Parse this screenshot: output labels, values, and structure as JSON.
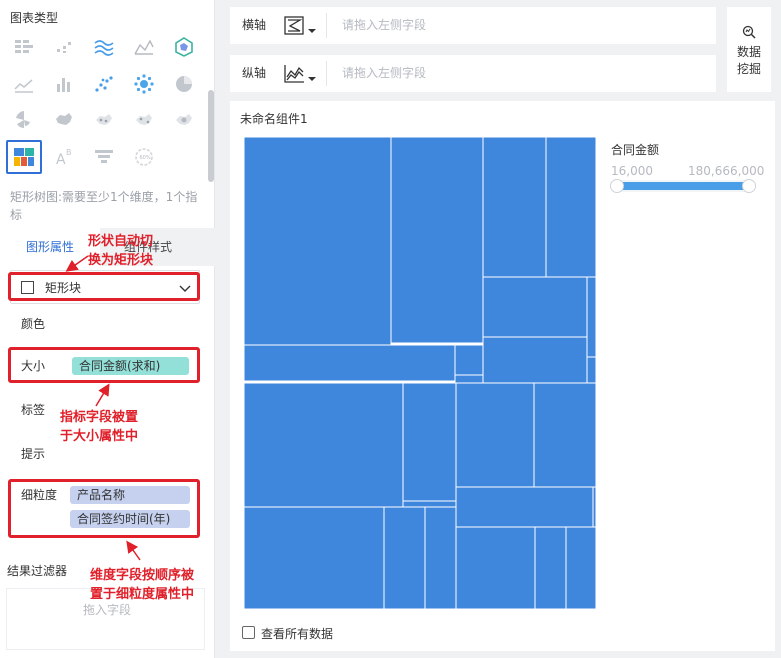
{
  "left_panel": {
    "chart_type_title": "图表类型",
    "chart_icons": [
      "table-icon",
      "scatter-small-icon",
      "multi-line-icon",
      "area-line-icon",
      "radar-icon",
      "line-icon",
      "bar-icon",
      "dot-scatter-icon",
      "bubble-icon",
      "pie-icon",
      "rose-icon",
      "china-map-icon",
      "point-map-icon",
      "flow-map-icon",
      "heat-map-icon",
      "treemap-icon",
      "text-icon",
      "funnel-icon",
      "gauge-icon"
    ],
    "hint": "矩形树图:需要至少1个维度，1个指标",
    "tabs": {
      "graph_props": "图形属性",
      "component_style": "组件样式"
    },
    "shape": "矩形块",
    "color_label": "颜色",
    "size_label": "大小",
    "size_field": "合同金额(求和)",
    "tag_label": "标签",
    "tip_label": "提示",
    "granularity_label": "细粒度",
    "granularity_fields": [
      "产品名称",
      "合同签约时间(年)"
    ],
    "filter_title": "结果过滤器",
    "filter_placeholder": "拖入字段"
  },
  "annotations": {
    "shape_note": [
      "形状自动切",
      "换为矩形块"
    ],
    "size_note": [
      "指标字段被置",
      "于大小属性中"
    ],
    "dim_note": [
      "维度字段按顺序被",
      "置于细粒度属性中"
    ]
  },
  "axes": {
    "x_label": "横轴",
    "y_label": "纵轴",
    "x_placeholder": "请拖入左侧字段",
    "y_placeholder": "请拖入左侧字段"
  },
  "mining_button": "数据挖掘",
  "chart": {
    "title": "未命名组件1",
    "legend_title": "合同金额",
    "legend_min": "16,000",
    "legend_max": "180,666,000",
    "view_all": "查看所有数据",
    "fill_color": "#3f86dd",
    "border_color": "#ffffff"
  },
  "chart_data": {
    "type": "treemap",
    "title": "未命名组件1",
    "legend": {
      "title": "合同金额",
      "min": 16000,
      "max": 180666000
    }
  }
}
